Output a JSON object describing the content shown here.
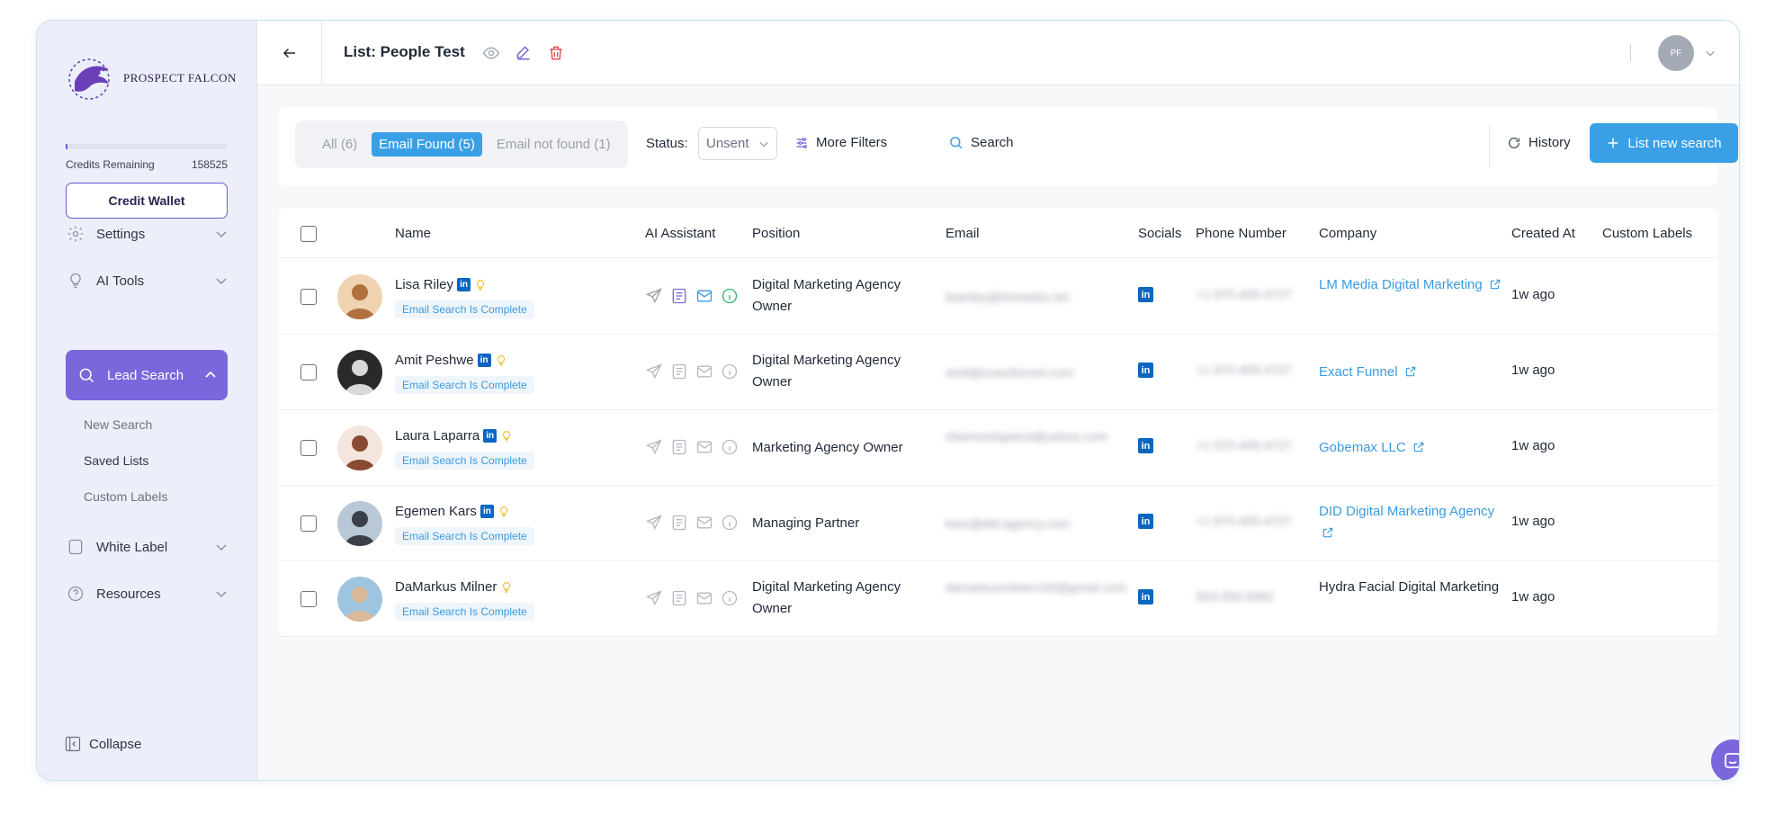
{
  "brand": {
    "name": "PROSPECT FALCON",
    "accent": "#7b66db",
    "link": "#3a9be0"
  },
  "sidebar": {
    "credits_label": "Credits Remaining",
    "credits_value": "158525",
    "credits_fraction": 0.01,
    "wallet_label": "Credit Wallet",
    "items": [
      {
        "label": "Settings",
        "icon": "gear-icon"
      },
      {
        "label": "AI Tools",
        "icon": "lightbulb-icon"
      },
      {
        "label": "Lead Search",
        "icon": "search-icon"
      },
      {
        "label": "White Label",
        "icon": "tag-icon"
      },
      {
        "label": "Resources",
        "icon": "help-icon"
      }
    ],
    "sub_items": [
      {
        "label": "New Search"
      },
      {
        "label": "Saved Lists"
      },
      {
        "label": "Custom Labels"
      }
    ],
    "collapse_label": "Collapse"
  },
  "header": {
    "title": "List: People Test",
    "avatar_initials": "PF"
  },
  "toolbar": {
    "filters": [
      {
        "label": "All (6)"
      },
      {
        "label": "Email Found (5)"
      },
      {
        "label": "Email not found (1)"
      }
    ],
    "status_label": "Status:",
    "status_value": "Unsent",
    "more_filters": "More Filters",
    "search": "Search",
    "history": "History",
    "new_search": "List new search"
  },
  "table": {
    "columns": [
      "Name",
      "AI Assistant",
      "Position",
      "Email",
      "Socials",
      "Phone Number",
      "Company",
      "Created At",
      "Custom Labels"
    ],
    "rows": [
      {
        "name": "Lisa Riley",
        "linkedin": true,
        "status": "Email Search Is Complete",
        "position": "Digital Marketing Agency Owner",
        "email": "lisariley@lmmedia.net",
        "phone": "+1 970-405-4727",
        "company": "LM Media Digital Marketing",
        "company_link": true,
        "created": "1w ago"
      },
      {
        "name": "Amit Peshwe",
        "linkedin": true,
        "status": "Email Search Is Complete",
        "position": "Digital Marketing Agency Owner",
        "email": "amit@exactfunnel.com",
        "phone": "+1 970-405-4727",
        "company": "Exact Funnel",
        "company_link": true,
        "created": "1w ago"
      },
      {
        "name": "Laura Laparra",
        "linkedin": true,
        "status": "Email Search Is Complete",
        "position": "Marketing Agency Owner",
        "email": "shannonlaparra@yahoo.com",
        "phone": "+1 970-405-4727",
        "company": "Gobemax LLC",
        "company_link": true,
        "created": "1w ago"
      },
      {
        "name": "Egemen Kars",
        "linkedin": true,
        "status": "Email Search Is Complete",
        "position": "Managing Partner",
        "email": "kars@did-agency.com",
        "phone": "+1 970-405-4727",
        "company": "DID Digital Marketing Agency",
        "company_link": true,
        "created": "1w ago"
      },
      {
        "name": "DaMarkus Milner",
        "linkedin": false,
        "status": "Email Search Is Complete",
        "position": "Digital Marketing Agency Owner",
        "email": "damarkusmilner193@gmail.com",
        "phone": "303-350-8992",
        "company": "Hydra Facial Digital Marketing",
        "company_link": false,
        "created": "1w ago"
      }
    ]
  }
}
